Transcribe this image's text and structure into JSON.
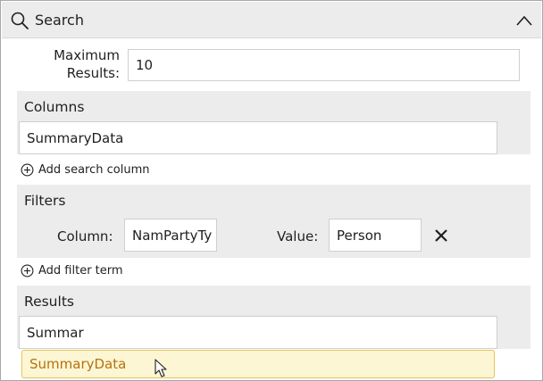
{
  "header": {
    "title": "Search",
    "icon": "search-icon",
    "collapse_icon": "chevron-up-icon"
  },
  "max_results": {
    "label_line1": "Maximum",
    "label_line2": "Results:",
    "value": "10"
  },
  "columns": {
    "title": "Columns",
    "value": "SummaryData",
    "add_label": "Add search column"
  },
  "filters": {
    "title": "Filters",
    "column_label": "Column:",
    "column_value": "NamPartyTy",
    "value_label": "Value:",
    "value_value": "Person",
    "remove_icon": "close-icon",
    "add_label": "Add filter term"
  },
  "results": {
    "title": "Results",
    "input_value": "Summar",
    "suggestion": "SummaryData"
  },
  "colors": {
    "panel_bg": "#ececec",
    "suggest_bg": "#fdf6d4",
    "suggest_border": "#e3c45a",
    "suggest_text": "#b5720f"
  }
}
